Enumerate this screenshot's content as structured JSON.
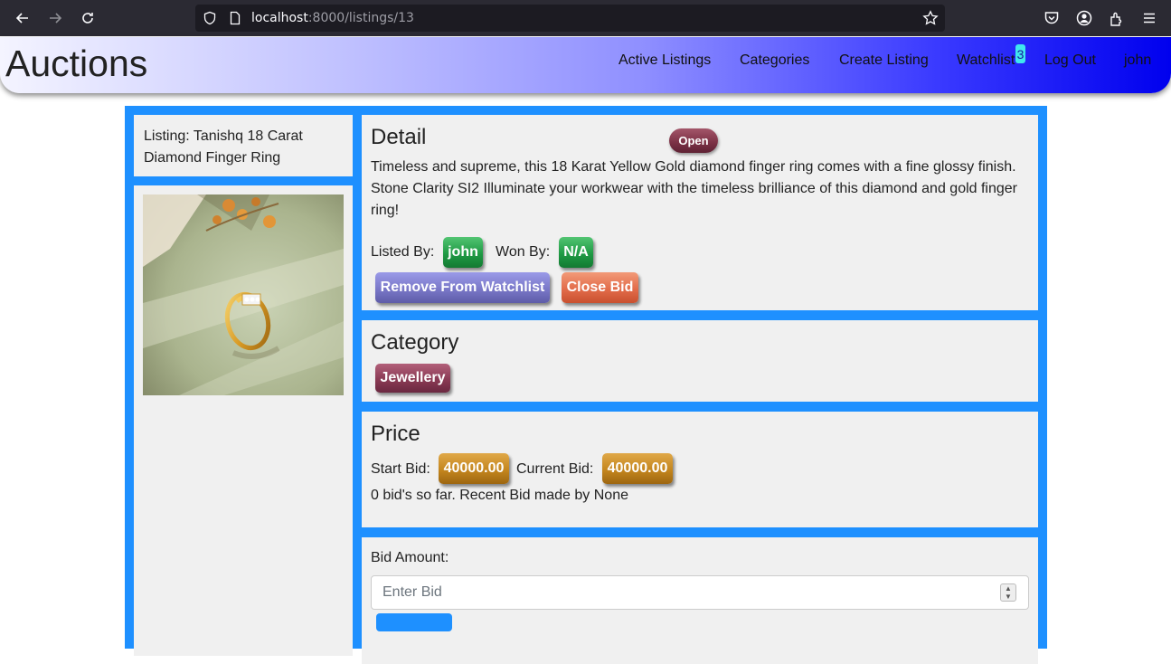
{
  "browser": {
    "url_host": "localhost",
    "url_rest": ":8000/listings/13"
  },
  "navbar": {
    "brand": "Auctions",
    "links": {
      "active_listings": "Active Listings",
      "categories": "Categories",
      "create_listing": "Create Listing",
      "watchlist": "Watchlist",
      "watchlist_count": "3",
      "log_out": "Log Out",
      "user": "john"
    }
  },
  "listing": {
    "title": "Listing: Tanishq 18 Carat Diamond Finger Ring",
    "detail_heading": "Detail",
    "status": "Open",
    "description": "Timeless and supreme, this 18 Karat Yellow Gold diamond finger ring comes with a fine glossy finish. Stone Clarity SI2 Illuminate your workwear with the timeless brilliance of this diamond and gold finger ring!",
    "listed_by_label": "Listed By:",
    "listed_by": "john",
    "won_by_label": "Won By:",
    "won_by": "N/A",
    "remove_watchlist_label": "Remove From Watchlist",
    "close_bid_label": "Close Bid"
  },
  "category": {
    "heading": "Category",
    "name": "Jewellery"
  },
  "price": {
    "heading": "Price",
    "start_bid_label": "Start Bid:",
    "start_bid": "40000.00",
    "current_bid_label": "Current Bid:",
    "current_bid": "40000.00",
    "summary": "0 bid's so far. Recent Bid made by None"
  },
  "bid_form": {
    "label": "Bid Amount:",
    "placeholder": "Enter Bid"
  },
  "colors": {
    "wrapper": "#1e90ff",
    "panel": "#f0f0f0",
    "navbar_end": "#0000ee"
  }
}
